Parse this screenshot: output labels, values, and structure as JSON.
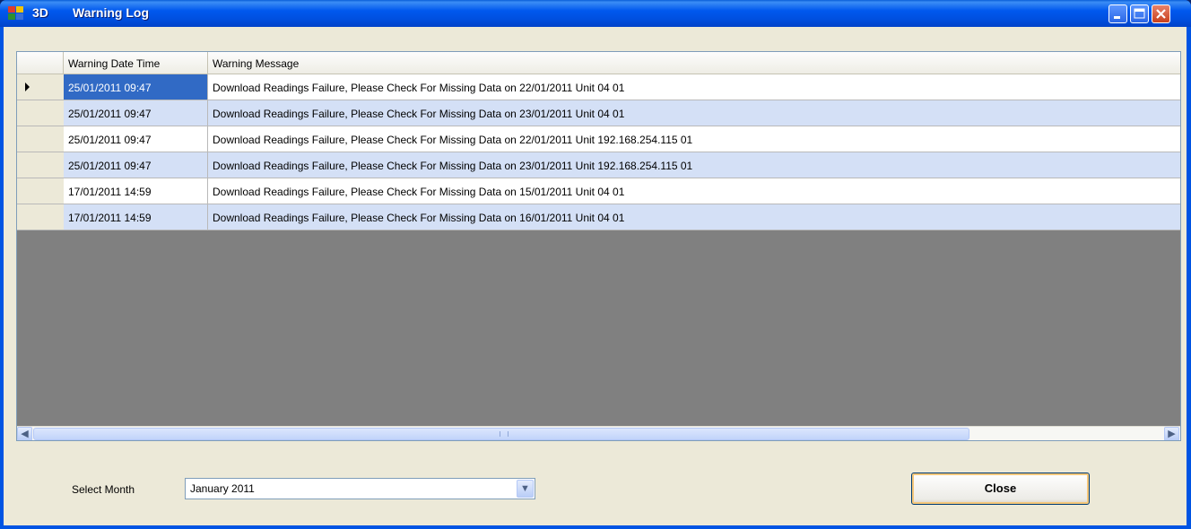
{
  "window": {
    "title_prefix": "3D",
    "title": "Warning Log",
    "controls": [
      "minimize-icon",
      "maximize-icon",
      "close-icon"
    ]
  },
  "grid": {
    "columns": [
      "Warning Date Time",
      "Warning Message"
    ],
    "rows": [
      {
        "datetime": "25/01/2011 09:47",
        "message": "Download Readings Failure, Please Check For Missing Data on 22/01/2011 Unit 04 01"
      },
      {
        "datetime": "25/01/2011 09:47",
        "message": "Download Readings Failure, Please Check For Missing Data on 23/01/2011 Unit 04 01"
      },
      {
        "datetime": "25/01/2011 09:47",
        "message": "Download Readings Failure, Please Check For Missing Data on 22/01/2011 Unit 192.168.254.115 01"
      },
      {
        "datetime": "25/01/2011 09:47",
        "message": "Download Readings Failure, Please Check For Missing Data on 23/01/2011 Unit 192.168.254.115 01"
      },
      {
        "datetime": "17/01/2011 14:59",
        "message": "Download Readings Failure, Please Check For Missing Data on 15/01/2011 Unit 04 01"
      },
      {
        "datetime": "17/01/2011 14:59",
        "message": "Download Readings Failure, Please Check For Missing Data on 16/01/2011 Unit 04 01"
      }
    ],
    "selected_row": 0
  },
  "footer": {
    "select_month_label": "Select Month",
    "month_value": "January 2011",
    "close_label": "Close"
  },
  "colors": {
    "titlebar": "#0054e3",
    "selection": "#316ac5",
    "alt_row": "#d4e0f6"
  }
}
